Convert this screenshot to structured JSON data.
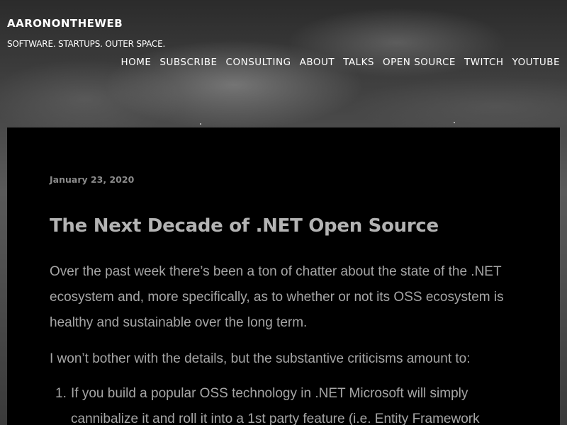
{
  "site": {
    "title": "AARONONTHEWEB",
    "tagline": "SOFTWARE. STARTUPS. OUTER SPACE."
  },
  "nav": {
    "items": [
      {
        "label": "HOME"
      },
      {
        "label": "SUBSCRIBE"
      },
      {
        "label": "CONSULTING"
      },
      {
        "label": "ABOUT"
      },
      {
        "label": "TALKS"
      },
      {
        "label": "OPEN SOURCE"
      },
      {
        "label": "TWITCH"
      },
      {
        "label": "YOUTUBE"
      }
    ]
  },
  "post": {
    "date": "January 23, 2020",
    "title": "The Next Decade of .NET Open Source",
    "paragraphs": [
      "Over the past week there’s been a ton of chatter about the state of the .NET ecosystem and, more specifically, as to whether or not its OSS ecosystem is healthy and sustainable over the long term.",
      "I won’t bother with the details, but the substantive criticisms amount to:"
    ],
    "list": [
      {
        "number": "1.",
        "text": "If you build a popular OSS technology in .NET Microsoft will simply cannibalize it and roll it into a 1st party feature (i.e. Entity Framework"
      }
    ]
  },
  "colors": {
    "article_bg": "#000000",
    "body_text": "#a6a6a6",
    "title_text": "#b3b3b3",
    "date_text": "#8a8a8a",
    "header_text": "#ffffff"
  }
}
